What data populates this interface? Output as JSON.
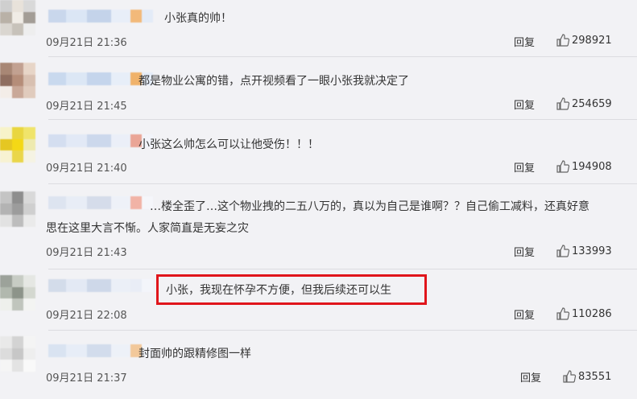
{
  "comments": [
    {
      "text": "小张真的帅！",
      "time": "09月21日 21:36",
      "reply_label": "回复",
      "likes": "298921",
      "avatar_colors": [
        "#cfcfcf",
        "#e8e2da",
        "#d9d9d9",
        "#b9b1a7",
        "#f0ece6",
        "#a39d96",
        "#dad6d0",
        "#c7c2ba",
        "#eeeeee"
      ],
      "name_colors": [
        "#c9d7ec",
        "#dbe6f5",
        "#c4d3ea",
        "#e8eef8",
        "#f2b97a",
        "#e3ebf7"
      ]
    },
    {
      "text": "都是物业公寓的错，点开视频看了一眼小张我就决定了",
      "time": "09月21日 21:45",
      "reply_label": "回复",
      "likes": "254659",
      "avatar_colors": [
        "#a88775",
        "#c2a191",
        "#e7d5c7",
        "#8f6e60",
        "#b58d79",
        "#d8c0b1",
        "#f3ede8",
        "#c9a898",
        "#e0cbbd"
      ],
      "name_colors": [
        "#c9d9ee",
        "#dce7f5",
        "#c5d5ec",
        "#e7eef8",
        "#f0b26a",
        "#e4ecf8"
      ]
    },
    {
      "text": "小张这么帅怎么可以让他受伤！！！",
      "time": "09月21日 21:40",
      "reply_label": "回复",
      "likes": "194908",
      "avatar_colors": [
        "#f7f3c9",
        "#e9d640",
        "#f0e46a",
        "#e5c722",
        "#f4d816",
        "#eeeab0",
        "#f7f2d2",
        "#ead64a",
        "#f5f3e3"
      ],
      "name_colors": [
        "#d4def0",
        "#e2e9f6",
        "#ccd8ec",
        "#ebeff8",
        "#eaa596",
        "#f2f4fa"
      ]
    },
    {
      "text": "…楼全歪了…这个物业拽的二五八万的，真以为自己是谁啊？？自己偷工减料，还真好意",
      "text2": "思在这里大言不惭。人家简直是无妄之灾",
      "time": "09月21日 21:43",
      "reply_label": "回复",
      "likes": "133993",
      "avatar_colors": [
        "#c4c4c4",
        "#8e8e8e",
        "#d9d9d9",
        "#b3b3b3",
        "#9c9c9c",
        "#cfcfcf",
        "#e2e2e2",
        "#bdbdbd",
        "#eaeaea"
      ],
      "name_colors": [
        "#dde4f0",
        "#e8edf6",
        "#d5dcea",
        "#eef1f8",
        "#f1b3a6",
        "#f5f6fa"
      ]
    },
    {
      "text": "小张，我现在怀孕不方便，但我后续还可以生",
      "time": "09月21日 22:08",
      "reply_label": "回复",
      "likes": "110286",
      "avatar_colors": [
        "#9ca29a",
        "#c7ccc4",
        "#e5e7e3",
        "#b1b8ae",
        "#8d948a",
        "#d4d8d0",
        "#eef0ec",
        "#c0c5bd",
        "#f3f4f2"
      ],
      "name_colors": [
        "#d3dcea",
        "#e3e9f4",
        "#ced8e9",
        "#ebeff7",
        "#e9edf6",
        "#f3f5fa"
      ]
    },
    {
      "text": "封面帅的跟精修图一样",
      "time": "09月21日 21:37",
      "reply_label": "回复",
      "likes": "83551",
      "avatar_colors": [
        "#e9e9e9",
        "#d3d3d3",
        "#f4f4f4",
        "#dcdcdc",
        "#c7c7c7",
        "#eeeeee",
        "#f5f5f5",
        "#e3e3e3",
        "#f9f9f9"
      ],
      "name_colors": [
        "#d9e3f1",
        "#e7edf7",
        "#d2dcec",
        "#edf1f8",
        "#f2c89a",
        "#f3f5fa"
      ]
    }
  ]
}
